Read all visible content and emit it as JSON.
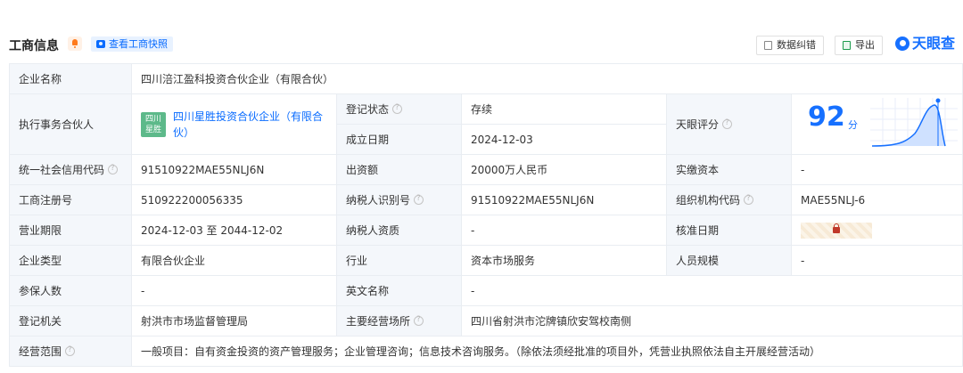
{
  "header": {
    "title": "工商信息",
    "snapshot_label": "查看工商快照",
    "correct_label": "数据纠错",
    "export_label": "导出",
    "brand": "天眼查"
  },
  "fields": {
    "company_name_label": "企业名称",
    "company_name": "四川涪江盈科投资合伙企业（有限合伙）",
    "partner_label": "执行事务合伙人",
    "partner_logo_line1": "四川",
    "partner_logo_line2": "星胜",
    "partner_name": "四川星胜投资合伙企业（有限合伙）",
    "reg_status_label": "登记状态",
    "reg_status": "存续",
    "established_label": "成立日期",
    "established": "2024-12-03",
    "rating_label": "天眼评分",
    "score": "92",
    "score_unit": "分",
    "credit_code_label": "统一社会信用代码",
    "credit_code": "91510922MAE55NLJ6N",
    "capital_label": "出资额",
    "capital": "20000万人民币",
    "paid_capital_label": "实缴资本",
    "paid_capital": "-",
    "reg_no_label": "工商注册号",
    "reg_no": "510922200056335",
    "taxpayer_id_label": "纳税人识别号",
    "taxpayer_id": "91510922MAE55NLJ6N",
    "org_code_label": "组织机构代码",
    "org_code": "MAE55NLJ-6",
    "term_label": "营业期限",
    "term": "2024-12-03 至 2044-12-02",
    "taxpayer_qual_label": "纳税人资质",
    "taxpayer_qual": "-",
    "approval_date_label": "核准日期",
    "company_type_label": "企业类型",
    "company_type": "有限合伙企业",
    "industry_label": "行业",
    "industry": "资本市场服务",
    "staff_size_label": "人员规模",
    "staff_size": "-",
    "insured_label": "参保人数",
    "insured": "-",
    "english_name_label": "英文名称",
    "english_name": "-",
    "authority_label": "登记机关",
    "authority": "射洪市市场监督管理局",
    "address_label": "主要经营场所",
    "address": "四川省射洪市沱牌镇欣安驾校南侧",
    "scope_label": "经营范围",
    "scope": "一般项目：自有资金投资的资产管理服务；企业管理咨询；信息技术咨询服务。（除依法须经批准的项目外，凭营业执照依法自主开展经营活动）"
  },
  "colors": {
    "brand_blue": "#1670ff",
    "status_green": "#1b9e4b",
    "label_bg": "#f4f7fb"
  }
}
